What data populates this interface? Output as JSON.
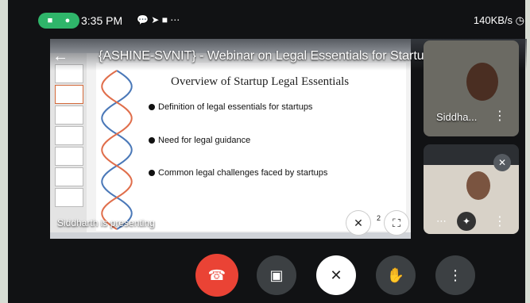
{
  "status_bar": {
    "time": "3:35 PM",
    "net_speed": "140KB/s",
    "extra_icons": "⋯"
  },
  "meeting": {
    "title": "{ASHINE-SVNIT} - Webinar on Legal Essentials for Startup Success: ...",
    "presenting_label": "Siddharth is presenting"
  },
  "slide": {
    "title": "Overview of Startup Legal Essentials",
    "bullets": [
      "Definition of legal essentials for startups",
      "Need for legal guidance",
      "Common legal challenges faced by startups"
    ],
    "page_indicator": "2"
  },
  "participants": [
    {
      "name": "Siddha..."
    },
    {
      "name": ""
    }
  ],
  "colors": {
    "end_call": "#ea4335",
    "status_pill": "#2fb56a",
    "control_bg": "#3c4043"
  },
  "controls": {
    "end_call_icon": "phone-hangup-icon",
    "camera_icon": "camera-icon",
    "mic_icon": "mic-off-icon",
    "hand_icon": "raise-hand-icon",
    "more_icon": "more-vertical-icon"
  }
}
